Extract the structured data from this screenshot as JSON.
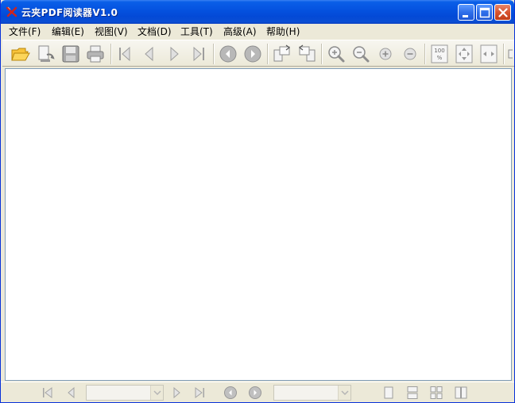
{
  "window": {
    "title": "云夹PDF阅读器V1.0",
    "app_icon": "red-x-logo-icon",
    "controls": [
      "minimize-icon",
      "maximize-icon",
      "close-icon"
    ],
    "accent_color": "#0553e0"
  },
  "menubar": {
    "items": [
      "文件(F)",
      "编辑(E)",
      "视图(V)",
      "文档(D)",
      "工具(T)",
      "高级(A)",
      "帮助(H)"
    ]
  },
  "toolbar": {
    "groups": [
      [
        "open-folder-icon",
        "open-recent-icon",
        "save-icon",
        "print-icon"
      ],
      [
        "first-page-icon",
        "previous-page-icon",
        "next-page-icon",
        "last-page-icon"
      ],
      [
        "back-icon",
        "forward-icon"
      ],
      [
        "rotate-clockwise-icon",
        "rotate-counterclockwise-icon"
      ],
      [
        "zoom-in-tool-icon",
        "zoom-out-tool-icon",
        "zoom-in-icon",
        "zoom-out-icon"
      ],
      [
        "actual-size-icon",
        "fit-page-icon",
        "fit-width-icon"
      ]
    ],
    "actual_size_label": "100\n%"
  },
  "statusbar": {
    "page_input_value": "",
    "zoom_select_value": "",
    "view_modes": [
      "single-page-icon",
      "continuous-icon",
      "facing-icon",
      "continuous-facing-icon"
    ]
  }
}
